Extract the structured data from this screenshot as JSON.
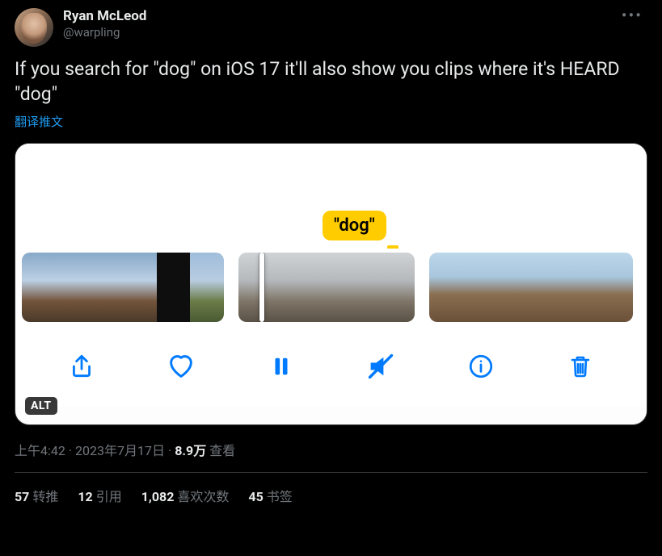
{
  "author": {
    "display_name": "Ryan McLeod",
    "handle": "@warpling"
  },
  "tweet_text": "If you search for \"dog\" on iOS 17 it'll also show you clips where it's HEARD \"dog\"",
  "translate_label": "翻译推文",
  "media": {
    "caption_bubble": "\"dog\"",
    "alt_badge": "ALT",
    "toolbar_icons": [
      "share",
      "like",
      "pause",
      "mute",
      "info",
      "trash"
    ]
  },
  "timestamp": {
    "time": "上午4:42",
    "date": "2023年7月17日",
    "views_count": "8.9万",
    "views_label": "查看"
  },
  "stats": {
    "retweets": {
      "count": "57",
      "label": "转推"
    },
    "quotes": {
      "count": "12",
      "label": "引用"
    },
    "likes": {
      "count": "1,082",
      "label": "喜欢次数"
    },
    "bookmarks": {
      "count": "45",
      "label": "书签"
    }
  }
}
